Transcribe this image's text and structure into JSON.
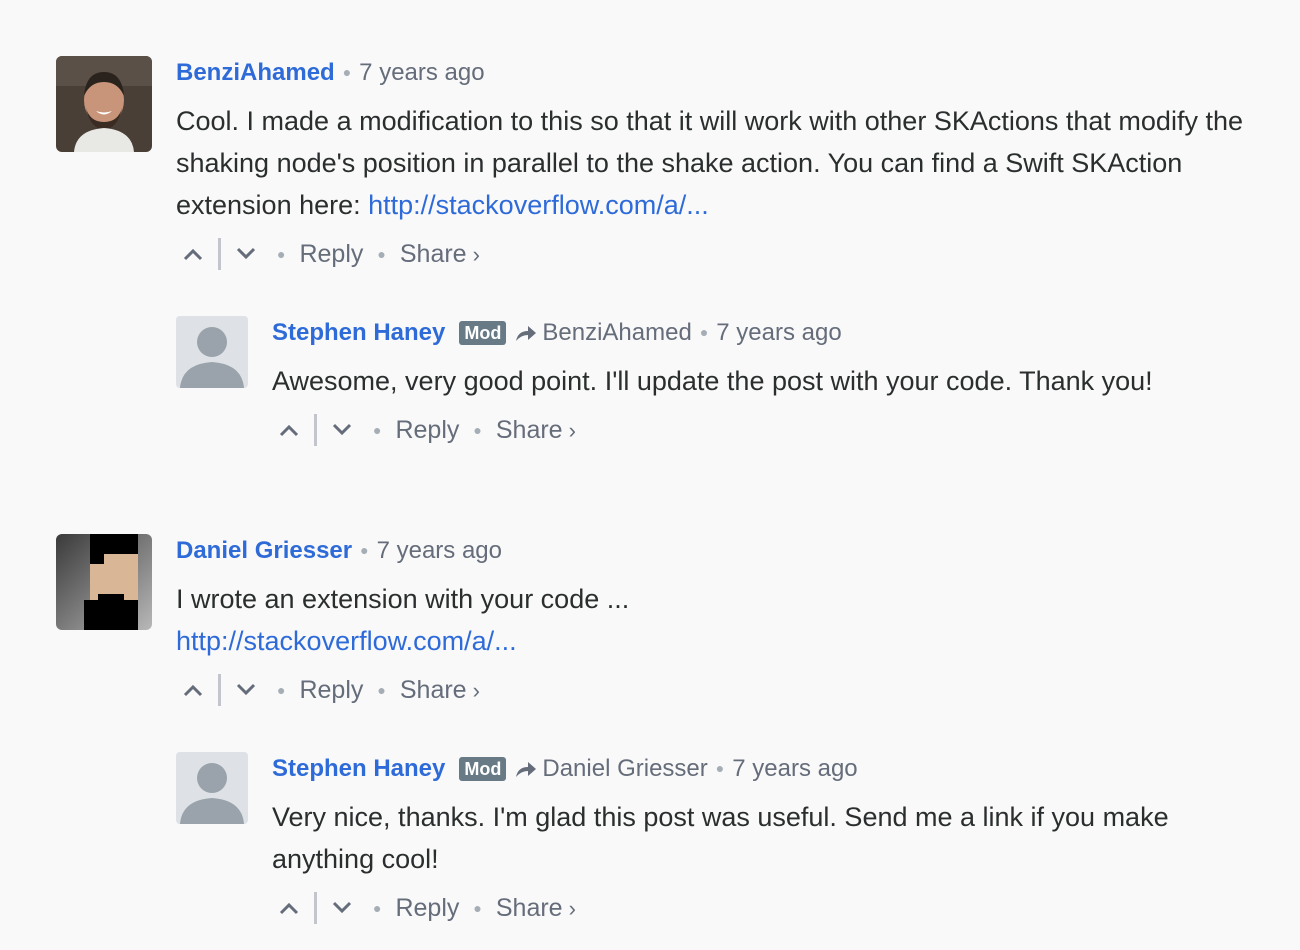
{
  "comments": [
    {
      "author": "BenziAhamed",
      "time": "7 years ago",
      "text": "Cool. I made a modification to this so that it will work with other SKActions that modify the shaking node's position in parallel to the shake action. You can find a Swift SKAction extension here: ",
      "link": "http://stackoverflow.com/a/...",
      "reply_label": "Reply",
      "share_label": "Share",
      "share_caret": "›",
      "avatar_icon": "user-photo-avatar"
    },
    {
      "author": "Stephen Haney",
      "badge": "Mod",
      "in_reply_to": "BenziAhamed",
      "time": "7 years ago",
      "text": "Awesome, very good point. I'll update the post with your code. Thank you!",
      "reply_label": "Reply",
      "share_label": "Share",
      "share_caret": "›",
      "avatar_icon": "default-user-avatar"
    },
    {
      "author": "Daniel Griesser",
      "time": "7 years ago",
      "text": "I wrote an extension with your code ...",
      "link": "http://stackoverflow.com/a/...",
      "reply_label": "Reply",
      "share_label": "Share",
      "share_caret": "›",
      "avatar_icon": "pixel-art-avatar"
    },
    {
      "author": "Stephen Haney",
      "badge": "Mod",
      "in_reply_to": "Daniel Griesser",
      "time": "7 years ago",
      "text": "Very nice, thanks. I'm glad this post was useful. Send me a link if you make anything cool!",
      "reply_label": "Reply",
      "share_label": "Share",
      "share_caret": "›",
      "avatar_icon": "default-user-avatar"
    }
  ],
  "colors": {
    "author": "#2e6bd8",
    "link": "#2e6bd8",
    "muted": "#656c7a",
    "badge": "#687a86",
    "background": "#f9f9f9"
  }
}
